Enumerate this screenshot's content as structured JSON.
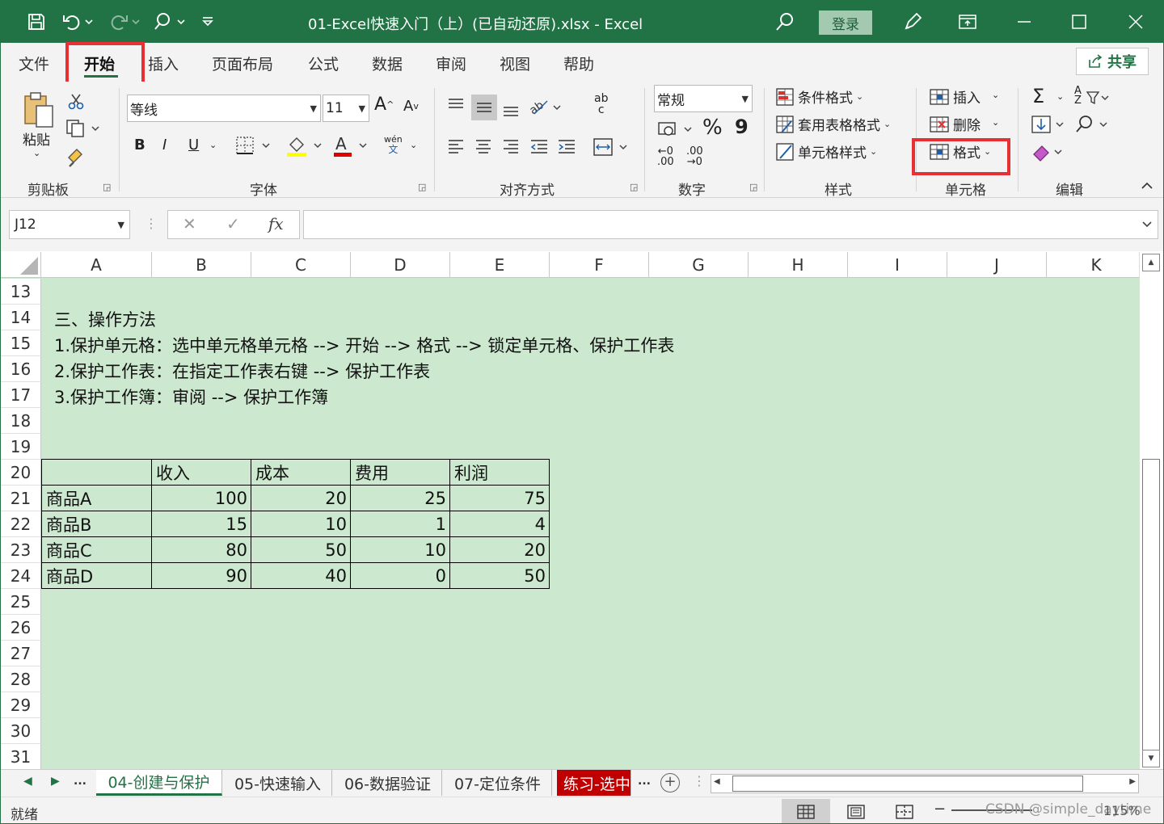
{
  "window": {
    "title": "01-Excel快速入门（上）(已自动还原).xlsx  -  Excel",
    "login_label": "登录"
  },
  "ribbon_tabs": [
    "文件",
    "开始",
    "插入",
    "页面布局",
    "公式",
    "数据",
    "审阅",
    "视图",
    "帮助"
  ],
  "active_tab": "开始",
  "share_label": "共享",
  "clipboard": {
    "paste_label": "粘贴",
    "group_label": "剪贴板"
  },
  "font": {
    "name": "等线",
    "size": "11",
    "grow": "A",
    "shrink": "A",
    "bold": "B",
    "italic": "I",
    "underline": "U",
    "phonetic": "wén",
    "phonetic_sub": "文",
    "group_label": "字体"
  },
  "alignment": {
    "wrap_top": "ab",
    "wrap_bottom": "c",
    "group_label": "对齐方式"
  },
  "number": {
    "format": "常规",
    "percent": "%",
    "comma": "9",
    "inc_top": "←0",
    "inc_bottom": ".00",
    "dec_top": ".00",
    "dec_bottom": "→0",
    "group_label": "数字"
  },
  "styles": {
    "conditional": "条件格式",
    "table_format": "套用表格格式",
    "cell_styles": "单元格样式",
    "group_label": "样式"
  },
  "cells": {
    "insert": "插入",
    "delete": "删除",
    "format": "格式",
    "group_label": "单元格"
  },
  "editing": {
    "sum": "Σ",
    "sort_top": "A",
    "sort_bottom": "Z",
    "group_label": "编辑"
  },
  "formula_bar": {
    "name_box": "J12",
    "fx": "fx",
    "cancel": "✕",
    "enter": "✓",
    "value": ""
  },
  "columns": [
    "A",
    "B",
    "C",
    "D",
    "E",
    "F",
    "G",
    "H",
    "I",
    "J",
    "K"
  ],
  "rows": [
    "13",
    "14",
    "15",
    "16",
    "17",
    "18",
    "19",
    "20",
    "21",
    "22",
    "23",
    "24",
    "25",
    "26",
    "27",
    "28",
    "29",
    "30",
    "31"
  ],
  "notes": [
    "三、操作方法",
    "1.保护单元格：选中单元格单元格 --> 开始 --> 格式 --> 锁定单元格、保护工作表",
    "2.保护工作表：在指定工作表右键 --> 保护工作表",
    "3.保护工作簿：审阅 --> 保护工作簿"
  ],
  "table": {
    "headers": [
      "",
      "收入",
      "成本",
      "费用",
      "利润"
    ],
    "rows": [
      [
        "商品A",
        "100",
        "20",
        "25",
        "75"
      ],
      [
        "商品B",
        "15",
        "10",
        "1",
        "4"
      ],
      [
        "商品C",
        "80",
        "50",
        "10",
        "20"
      ],
      [
        "商品D",
        "90",
        "40",
        "0",
        "50"
      ]
    ]
  },
  "sheet_tabs": [
    "04-创建与保护",
    "05-快速输入",
    "06-数据验证",
    "07-定位条件",
    "练习-选中"
  ],
  "active_sheet": "04-创建与保护",
  "sheet_more": "...",
  "status": {
    "ready": "就绪",
    "zoom": "115%"
  },
  "watermark": "CSDN @simple_daytime",
  "colors": {
    "accent": "#217346",
    "grid_bg": "#cce8cf",
    "highlight": "#e63034",
    "red_tab": "#c00000"
  }
}
